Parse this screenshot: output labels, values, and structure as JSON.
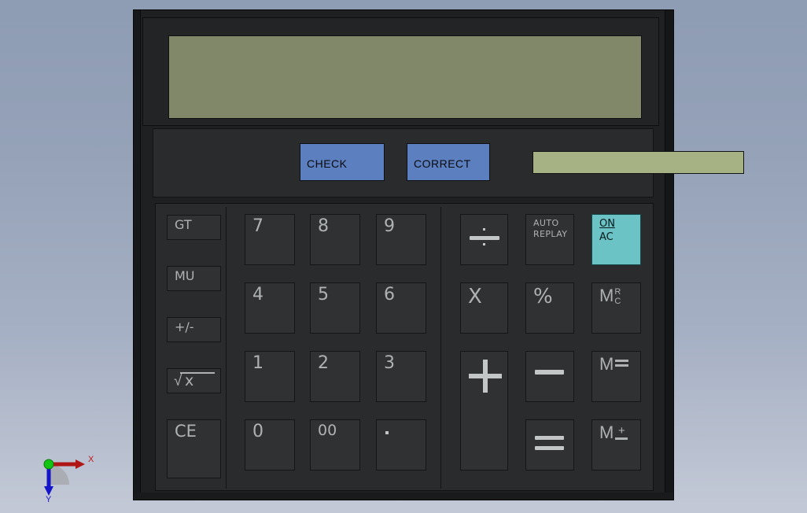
{
  "scene": {
    "title": "Calculator 3D CAD Model Viewport",
    "background_top_color": "#8e9cb4",
    "background_bottom_color": "#c3c9d6"
  },
  "calculator": {
    "body_color": "#1f2021",
    "panel_color": "#2a2b2d",
    "key_color": "#303133",
    "display": {
      "lcd_color": "#818769",
      "value": ""
    },
    "solar_panel": {
      "label": "",
      "color": "#a6b284"
    },
    "function_buttons": [
      {
        "name": "check",
        "label": "CHECK",
        "color": "#5c7fc0"
      },
      {
        "name": "correct",
        "label": "CORRECT",
        "color": "#5c7fc0"
      }
    ],
    "left_column_keys": [
      {
        "name": "gt",
        "label": "GT"
      },
      {
        "name": "mu",
        "label": "MU"
      },
      {
        "name": "sign-toggle",
        "label": "+/-"
      },
      {
        "name": "square-root",
        "label": "x"
      },
      {
        "name": "clear-entry",
        "label": "CE"
      }
    ],
    "number_keys": [
      {
        "name": "seven",
        "label": "7"
      },
      {
        "name": "eight",
        "label": "8"
      },
      {
        "name": "nine",
        "label": "9"
      },
      {
        "name": "four",
        "label": "4"
      },
      {
        "name": "five",
        "label": "5"
      },
      {
        "name": "six",
        "label": "6"
      },
      {
        "name": "one",
        "label": "1"
      },
      {
        "name": "two",
        "label": "2"
      },
      {
        "name": "three",
        "label": "3"
      },
      {
        "name": "zero",
        "label": "0"
      },
      {
        "name": "double-zero",
        "label": "00"
      },
      {
        "name": "decimal-point",
        "label": ""
      }
    ],
    "operator_keys": [
      {
        "name": "divide",
        "label": ""
      },
      {
        "name": "auto-replay",
        "label": "AUTO\nREPLAY"
      },
      {
        "name": "on-ac",
        "label_top": "ON",
        "label_bottom": "AC",
        "color": "#6cc3c6"
      },
      {
        "name": "multiply",
        "label": "X"
      },
      {
        "name": "percent",
        "label": "%"
      },
      {
        "name": "memory-recall-clear",
        "label_main": "M",
        "label_sup_top": "R",
        "label_sup_bottom": "C"
      },
      {
        "name": "plus",
        "label": "+"
      },
      {
        "name": "minus",
        "label": ""
      },
      {
        "name": "memory-equals",
        "label_main": "M"
      },
      {
        "name": "equals",
        "label": "="
      },
      {
        "name": "memory-plus-minus",
        "label_main": "M",
        "label_pm": "+"
      }
    ]
  },
  "axis_triad": {
    "x_label": "X",
    "y_label": "Y",
    "origin_label": "",
    "x_color": "#b01616",
    "y_color": "#1414c8",
    "origin_color": "#13c413"
  }
}
